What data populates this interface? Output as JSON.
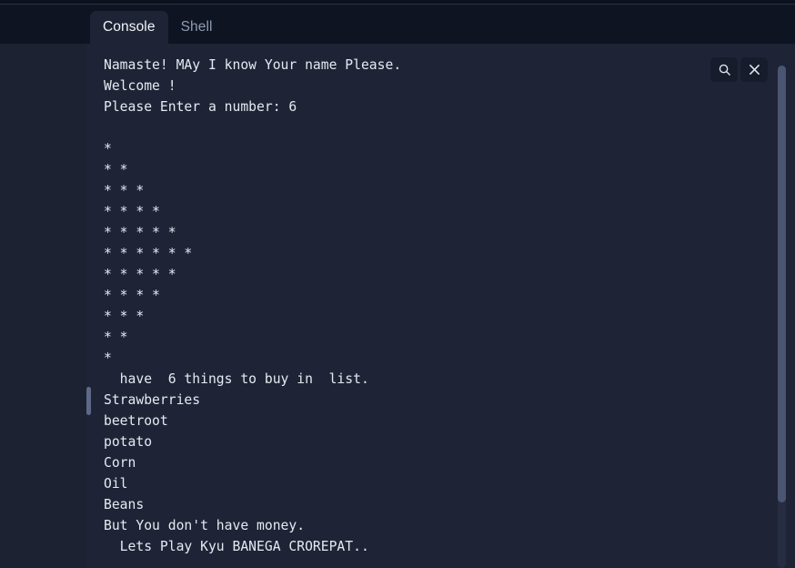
{
  "window": {
    "title": "Console"
  },
  "tabs": [
    {
      "id": "console",
      "label": "Console",
      "active": true
    },
    {
      "id": "shell",
      "label": "Shell",
      "active": false
    }
  ],
  "actions": {
    "search_label": "search-icon",
    "close_label": "close-icon"
  },
  "console": {
    "lines": [
      "Namaste! MAy I know Your name Please.",
      "Welcome !",
      "Please Enter a number: 6",
      "",
      "*",
      "* *",
      "* * *",
      "* * * *",
      "* * * * *",
      "* * * * * *",
      "* * * * *",
      "* * * *",
      "* * *",
      "* *",
      "*",
      "  have  6 things to buy in  list.",
      "Strawberries",
      "beetroot",
      "potato",
      "Corn",
      "Oil",
      "Beans",
      "But You don't have money.",
      "  Lets Play Kyu BANEGA CROREPAT.."
    ]
  },
  "colors": {
    "top_bar_bg": "#0e1421",
    "left_panel_bg": "#1c2232",
    "console_bg": "#1e2436",
    "text": "#e6e9f0",
    "tab_inactive_text": "#8f9bb3",
    "tab_active_text": "#f2f4f8",
    "scrollbar_thumb": "#5d6a87"
  }
}
